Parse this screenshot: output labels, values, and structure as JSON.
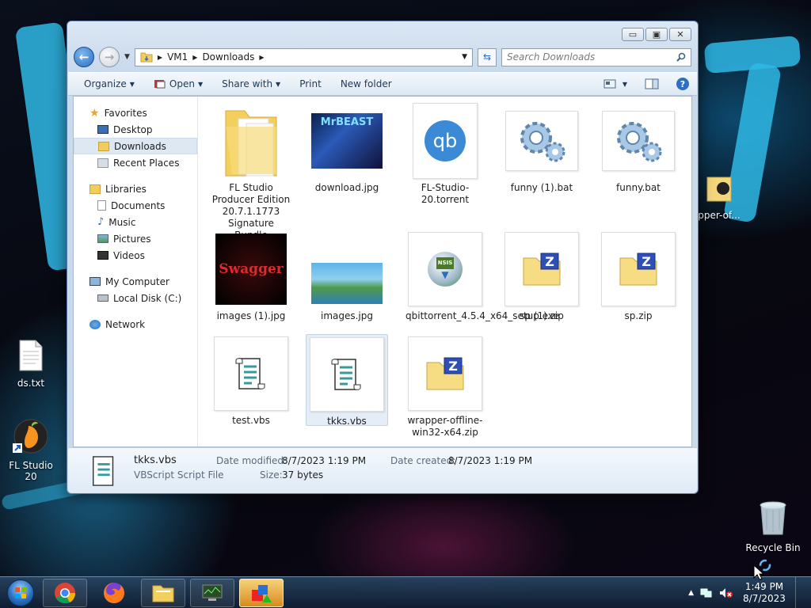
{
  "window": {
    "caption_buttons": {
      "minimize": "▭",
      "maximize": "▣",
      "close": "✕"
    },
    "address": {
      "crumbs": [
        "VM1",
        "Downloads"
      ]
    },
    "search": {
      "placeholder": "Search Downloads"
    },
    "toolbar": {
      "organize": "Organize",
      "open": "Open",
      "share_with": "Share with",
      "print": "Print",
      "new_folder": "New folder"
    },
    "nav": {
      "favorites": "Favorites",
      "desktop": "Desktop",
      "downloads": "Downloads",
      "recent_places": "Recent Places",
      "libraries": "Libraries",
      "documents": "Documents",
      "music": "Music",
      "pictures": "Pictures",
      "videos": "Videos",
      "my_computer": "My Computer",
      "local_disk": "Local Disk (C:)",
      "network": "Network"
    },
    "files": [
      {
        "name": "FL Studio Producer Edition 20.7.1.1773 Signature Bundle",
        "icon": "folder-icon"
      },
      {
        "name": "download.jpg",
        "icon": "image-icon",
        "thumb_text": "MrBEAST"
      },
      {
        "name": "FL-Studio-20.torrent",
        "icon": "qbittorrent-icon",
        "thumb_text": "qb"
      },
      {
        "name": "funny (1).bat",
        "icon": "gears-icon"
      },
      {
        "name": "funny.bat",
        "icon": "gears-icon"
      },
      {
        "name": "images (1).jpg",
        "icon": "image-icon",
        "thumb_text": "Swagger"
      },
      {
        "name": "images.jpg",
        "icon": "image-icon"
      },
      {
        "name": "qbittorrent_4.5.4_x64_setup.exe",
        "icon": "installer-icon",
        "thumb_text": "NSIS"
      },
      {
        "name": "sp (1).zip",
        "icon": "zip-icon"
      },
      {
        "name": "sp.zip",
        "icon": "zip-icon"
      },
      {
        "name": "test.vbs",
        "icon": "script-icon"
      },
      {
        "name": "tkks.vbs",
        "icon": "script-icon"
      },
      {
        "name": "wrapper-offline-win32-x64.zip",
        "icon": "zip-icon"
      }
    ],
    "details": {
      "name": "tkks.vbs",
      "type": "VBScript Script File",
      "date_modified_label": "Date modified:",
      "date_modified": "8/7/2023 1:19 PM",
      "date_created_label": "Date created:",
      "date_created": "8/7/2023 1:19 PM",
      "size_label": "Size:",
      "size": "37 bytes"
    }
  },
  "desktop": {
    "icons": {
      "ds": "ds.txt",
      "fl": "FL Studio 20",
      "recycle": "Recycle Bin",
      "wrapper": "pper-of..."
    }
  },
  "taskbar": {
    "time": "1:49 PM",
    "date": "8/7/2023"
  },
  "colors": {
    "accent": "#2a6fc0",
    "selection": "#dde8f3",
    "taskbar": "#1f3a57"
  }
}
